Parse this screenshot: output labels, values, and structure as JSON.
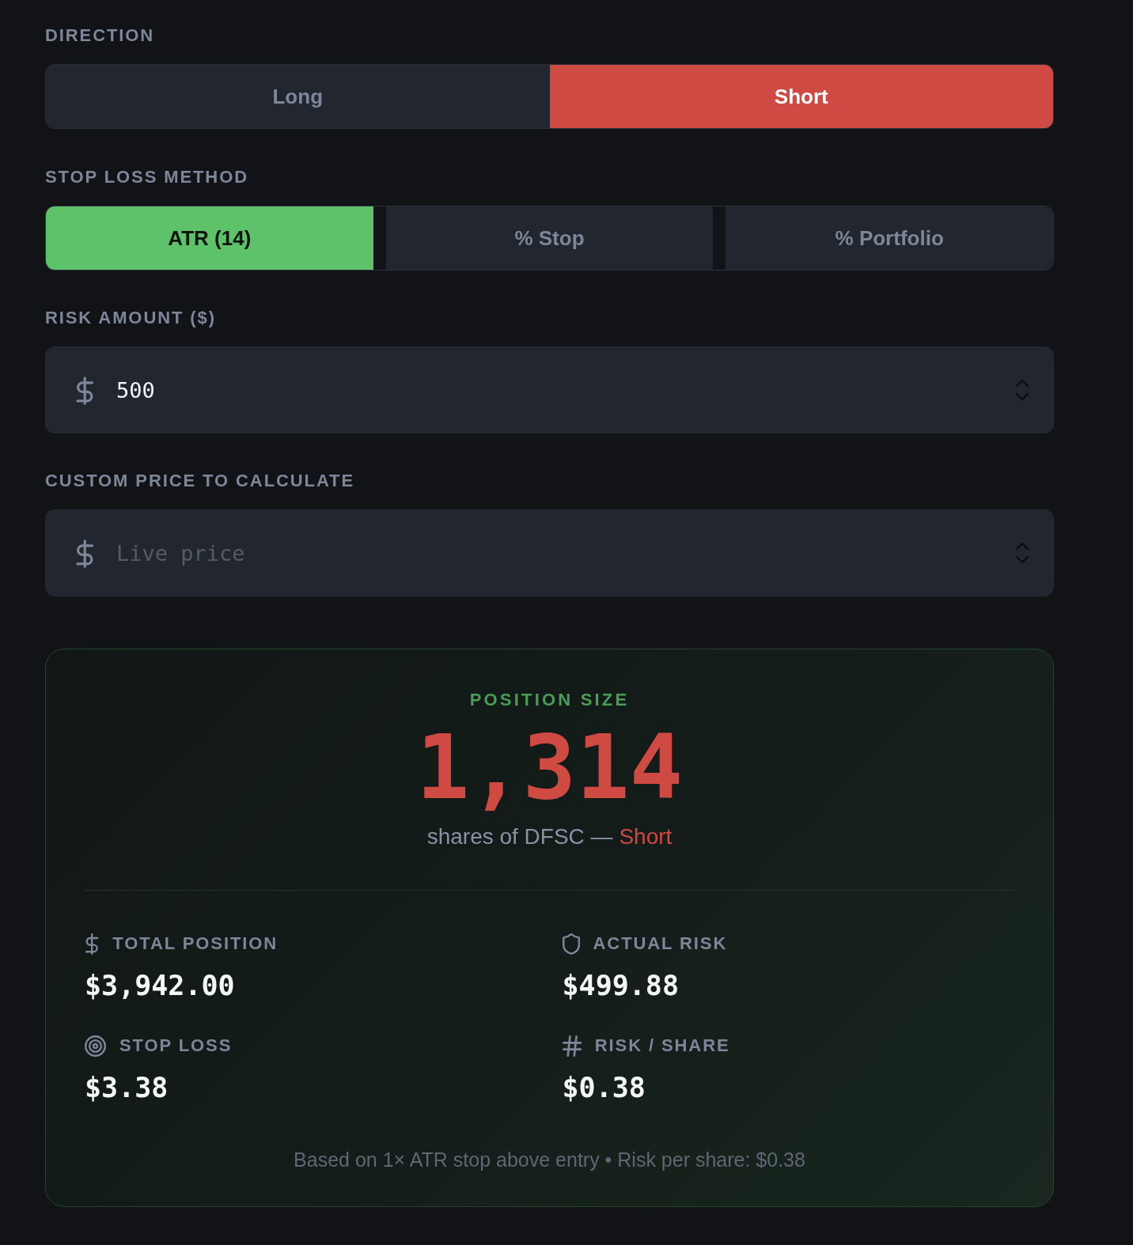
{
  "direction": {
    "label": "DIRECTION",
    "options": [
      {
        "label": "Long",
        "selected": false
      },
      {
        "label": "Short",
        "selected": true
      }
    ]
  },
  "stop_loss_method": {
    "label": "STOP LOSS METHOD",
    "options": [
      {
        "label": "ATR (14)",
        "selected": true
      },
      {
        "label": "% Stop",
        "selected": false
      },
      {
        "label": "% Portfolio",
        "selected": false
      }
    ]
  },
  "risk_amount": {
    "label": "RISK AMOUNT ($)",
    "value": "500"
  },
  "custom_price": {
    "label": "CUSTOM PRICE TO CALCULATE",
    "placeholder": "Live price"
  },
  "result": {
    "title": "POSITION SIZE",
    "shares": "1,314",
    "caption": "shares of DFSC —",
    "direction": "Short",
    "stats": [
      {
        "label": "TOTAL POSITION",
        "value": "$3,942.00"
      },
      {
        "label": "ACTUAL RISK",
        "value": "$499.88"
      },
      {
        "label": "STOP LOSS",
        "value": "$3.38"
      },
      {
        "label": "RISK / SHARE",
        "value": "$0.38"
      }
    ],
    "note": "Based on 1× ATR stop above entry • Risk per share: $0.38"
  }
}
